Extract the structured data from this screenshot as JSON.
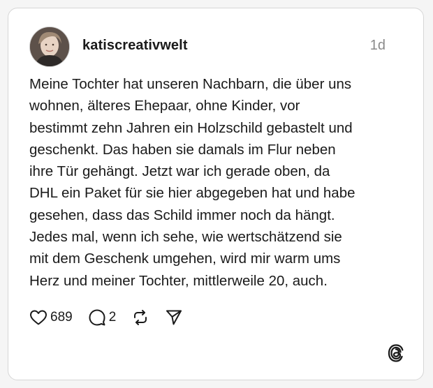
{
  "post": {
    "username": "katiscreativwelt",
    "time": "1d",
    "text": "Meine Tochter hat unseren Nachbarn, die über uns\nwohnen, älteres Ehepaar, ohne Kinder, vor\nbestimmt zehn Jahren ein Holzschild gebastelt und\ngeschenkt. Das haben sie damals im Flur neben\nihre Tür gehängt. Jetzt war ich gerade oben, da\nDHL ein Paket für sie hier abgegeben hat und habe\ngesehen, dass das Schild immer noch da hängt.\nJedes mal, wenn ich sehe, wie wertschätzend sie\nmit dem Geschenk umgehen, wird mir warm ums\nHerz und meiner Tochter, mittlerweile 20, auch.",
    "likes": "689",
    "replies": "2"
  },
  "icons": {
    "like": "heart-icon",
    "reply": "comment-icon",
    "repost": "repost-icon",
    "share": "send-icon",
    "brand": "threads-logo-icon"
  }
}
